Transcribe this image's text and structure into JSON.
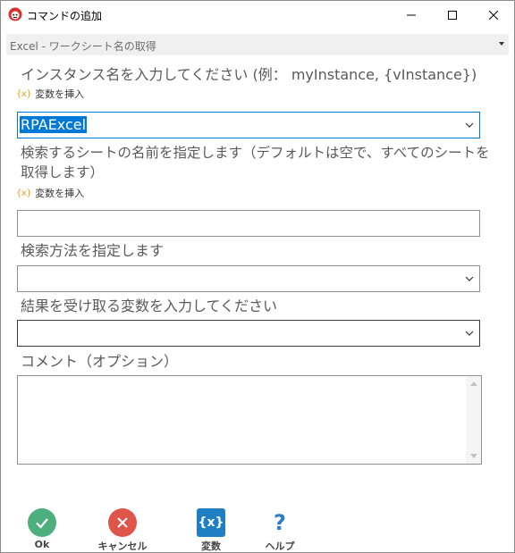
{
  "window": {
    "title": "コマンドの追加",
    "app_icon": "robot-red-icon"
  },
  "section": {
    "title": "Excel - ワークシート名の取得"
  },
  "fields": {
    "instance_label": "インスタンス名を入力してください (例： myInstance, {vInstance})",
    "insert_variable": "変数を挿入",
    "instance_value": "RPAExcel",
    "sheet_label": "検索するシートの名前を指定します（デフォルトは空で、すべてのシートを取得します）",
    "sheet_value": "",
    "search_method_label": "検索方法を指定します",
    "search_method_value": "",
    "result_var_label": "結果を受け取る変数を入力してください",
    "result_var_value": "",
    "comment_label": "コメント（オプション）",
    "comment_value": ""
  },
  "footer": {
    "ok_label": "Ok",
    "cancel_label": "キャンセル",
    "variable_label": "変数",
    "variable_glyph": "{x}",
    "help_label": "ヘルプ",
    "help_glyph": "?"
  },
  "colors": {
    "ok": "#4caf7d",
    "cancel": "#e0554a",
    "variable": "#1f7fc4",
    "help": "#2f7fc1",
    "selection": "#0078d7",
    "insert_icon": "#e8a317"
  }
}
